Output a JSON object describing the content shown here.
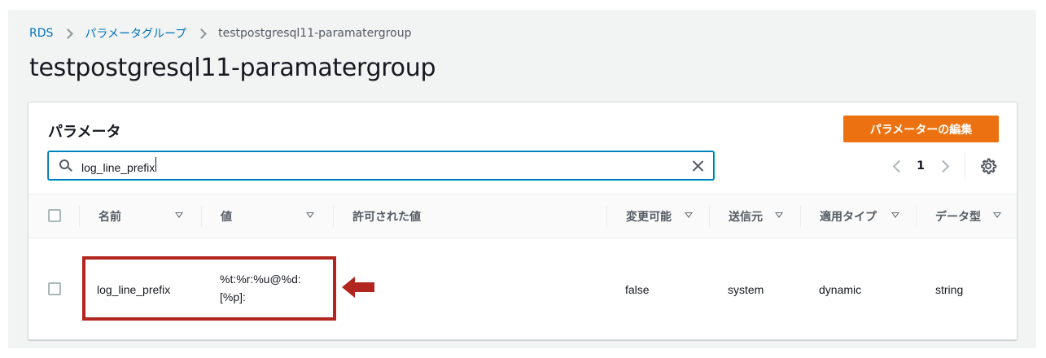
{
  "breadcrumb": {
    "items": [
      "RDS",
      "パラメータグループ"
    ],
    "current": "testpostgresql11-paramatergroup"
  },
  "page_title": "testpostgresql11-paramatergroup",
  "panel": {
    "title": "パラメータ",
    "edit_button_label": "パラメーターの編集"
  },
  "search": {
    "value": "log_line_prefix",
    "icon": "search-icon",
    "clear_icon": "close-icon"
  },
  "pagination": {
    "current_page": "1"
  },
  "table": {
    "columns": [
      "名前",
      "値",
      "許可された値",
      "変更可能",
      "送信元",
      "適用タイプ",
      "データ型"
    ],
    "rows": [
      {
        "name": "log_line_prefix",
        "value_line1": "%t:%r:%u@%d:",
        "value_line2": "[%p]:",
        "allowed_values": "",
        "modifiable": "false",
        "source": "system",
        "apply_type": "dynamic",
        "data_type": "string"
      }
    ]
  },
  "colors": {
    "link": "#0073bb",
    "primary_button": "#ec7211",
    "annotation_red": "#b1261e",
    "background": "#f2f3f3"
  }
}
